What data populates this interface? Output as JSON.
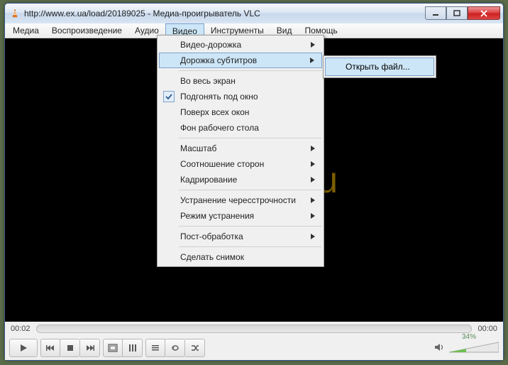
{
  "title": "http://www.ex.ua/load/20189025 - Медиа-проигрыватель VLC",
  "menubar": [
    "Медиа",
    "Воспроизведение",
    "Аудио",
    "Видео",
    "Инструменты",
    "Вид",
    "Помощь"
  ],
  "active_menu_index": 3,
  "dropdown": {
    "groups": [
      [
        {
          "label": "Видео-дорожка",
          "submenu": true
        },
        {
          "label": "Дорожка субтитров",
          "submenu": true,
          "highlight": true
        }
      ],
      [
        {
          "label": "Во весь экран"
        },
        {
          "label": "Подгонять под окно",
          "checked": true
        },
        {
          "label": "Поверх всех окон"
        },
        {
          "label": "Фон рабочего стола"
        }
      ],
      [
        {
          "label": "Масштаб",
          "submenu": true
        },
        {
          "label": "Соотношение сторон",
          "submenu": true
        },
        {
          "label": "Кадрирование",
          "submenu": true
        }
      ],
      [
        {
          "label": "Устранение чересстрочности",
          "submenu": true
        },
        {
          "label": "Режим устранения",
          "submenu": true
        }
      ],
      [
        {
          "label": "Пост-обработка",
          "submenu": true
        }
      ],
      [
        {
          "label": "Сделать снимок"
        }
      ]
    ]
  },
  "submenu_item": "Открыть файл...",
  "watermark": "cadelta.ru",
  "time": {
    "elapsed": "00:02",
    "total": "00:00"
  },
  "volume_percent": "34%",
  "icons": {
    "app": "vlc-cone-icon",
    "minimize": "minimize-icon",
    "maximize": "maximize-icon",
    "close": "close-icon",
    "play": "play-icon",
    "prev": "skip-prev-icon",
    "stop": "stop-icon",
    "next": "skip-next-icon",
    "fullscreen": "fullscreen-icon",
    "ext": "extended-settings-icon",
    "playlist": "playlist-icon",
    "loop": "loop-icon",
    "shuffle": "shuffle-icon",
    "speaker": "speaker-icon"
  }
}
